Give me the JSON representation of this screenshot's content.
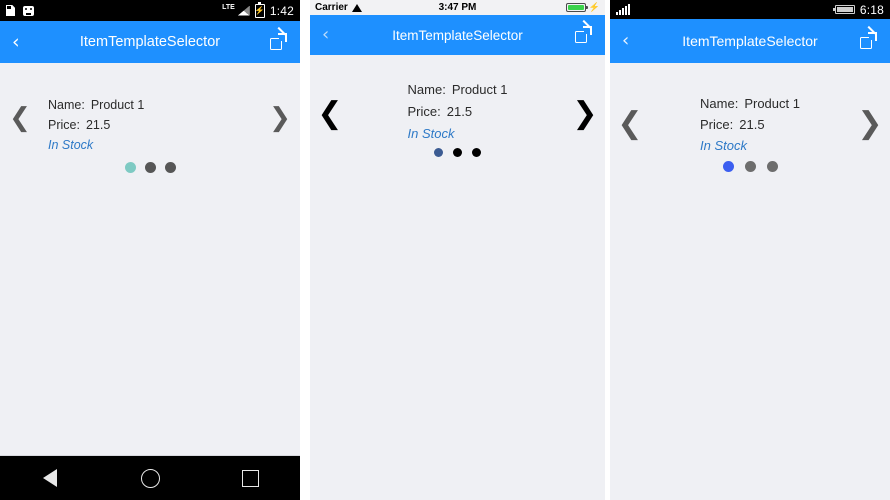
{
  "app": {
    "title": "ItemTemplateSelector",
    "accent_color": "#1e90ff",
    "content_background": "#eff0f4"
  },
  "item": {
    "name_label": "Name:",
    "name_value": "Product 1",
    "price_label": "Price:",
    "price_value": "21.5",
    "stock_status": "In Stock",
    "stock_color": "#2d79c7"
  },
  "nav": {
    "back_glyph": "‹",
    "prev_glyph": "❮",
    "next_glyph": "❯",
    "external_link_icon": "open-in-new-icon"
  },
  "panels": [
    {
      "id": "android",
      "platform": "Android",
      "statusbar": {
        "time": "1:42",
        "left_icons": [
          "sdcard-icon",
          "bug-icon"
        ],
        "right_icons": [
          "lte-signal-icon",
          "battery-charging-icon"
        ],
        "network_label": "LTE"
      },
      "dots": [
        {
          "color": "#7ecac3",
          "active": true
        },
        {
          "color": "#565656",
          "active": false
        },
        {
          "color": "#565656",
          "active": false
        }
      ],
      "softkeys": [
        "back-triangle-icon",
        "home-circle-icon",
        "recents-square-icon"
      ]
    },
    {
      "id": "ios",
      "platform": "iOS",
      "statusbar": {
        "carrier": "Carrier",
        "time": "3:47 PM",
        "left_icons": [
          "wifi-icon"
        ],
        "right_icons": [
          "battery-full-icon",
          "charging-bolt-icon"
        ]
      },
      "dots": [
        {
          "color": "#3b5b92",
          "active": true
        },
        {
          "color": "#000000",
          "active": false
        },
        {
          "color": "#000000",
          "active": false
        }
      ]
    },
    {
      "id": "winphone",
      "platform": "Windows Phone",
      "statusbar": {
        "time": "6:18",
        "left_icons": [
          "signal-bars-icon"
        ],
        "right_icons": [
          "battery-icon"
        ]
      },
      "dots": [
        {
          "color": "#3b5ef0",
          "active": true
        },
        {
          "color": "#6d6d6d",
          "active": false
        },
        {
          "color": "#6d6d6d",
          "active": false
        }
      ]
    }
  ]
}
